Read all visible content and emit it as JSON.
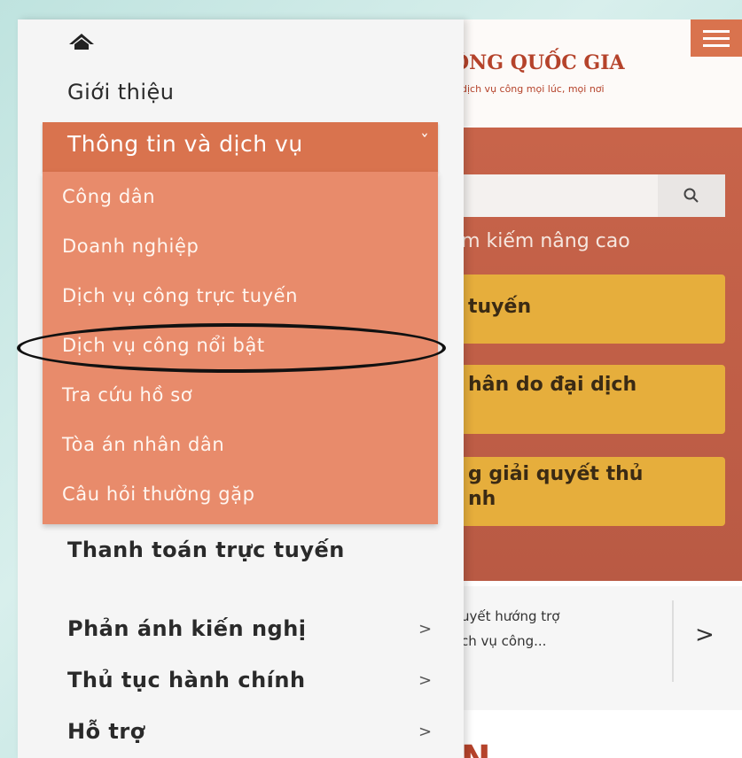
{
  "background_app": {
    "site_title": "ÔNG QUỐC GIA",
    "site_subtitle": "dịch vụ công mọi lúc, mọi nơi",
    "search_button_icon": "search-icon",
    "advanced_search_label": "ìm kiếm nâng cao",
    "gold_buttons": [
      {
        "label": "tuyến"
      },
      {
        "label": "hân do đại dịch"
      },
      {
        "label_line1": "g giải quyết thủ",
        "label_line2": "nh"
      }
    ],
    "support_card": {
      "line1": "uyết hướng trợ",
      "line2": "ch vụ công...",
      "arrow": ">"
    },
    "bottom_letter": "N"
  },
  "drawer": {
    "home_icon": "home-icon",
    "items": [
      {
        "label": "Giới thiệu"
      },
      {
        "label": "Thông tin và dịch vụ",
        "chevron": "ˇ",
        "expanded": true
      },
      {
        "label": "Thanh toán trực tuyến"
      },
      {
        "label": "Phản ánh kiến nghị",
        "chevron": ">"
      },
      {
        "label": "Thủ tục hành chính",
        "chevron": ">"
      },
      {
        "label": "Hỗ trợ",
        "chevron": ">"
      }
    ],
    "submenu": [
      "Công dân",
      "Doanh nghiệp",
      "Dịch vụ công trực tuyến",
      "Dịch vụ công nổi bật",
      "Tra cứu hồ sơ",
      "Tòa án nhân dân",
      "Câu hỏi thường gặp"
    ],
    "highlighted_submenu_index": 3
  },
  "colors": {
    "accent": "#d9734e",
    "submenu_bg": "#e88b6b",
    "hero": "#c8644a",
    "gold": "#e6ae3c"
  }
}
